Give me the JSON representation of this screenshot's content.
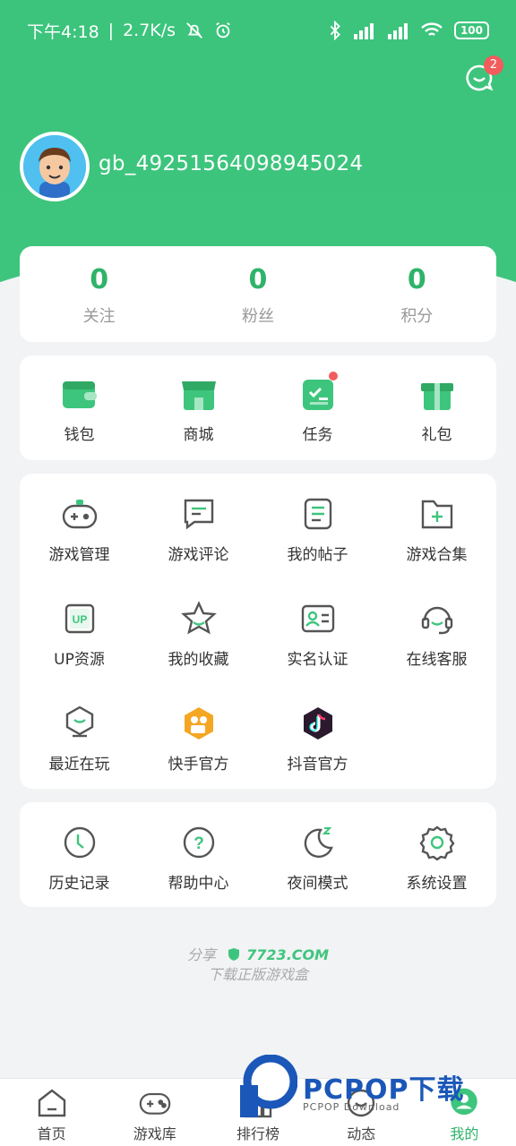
{
  "status_bar": {
    "time": "下午4:18",
    "speed": "2.7K/s",
    "battery": "100"
  },
  "header": {
    "message_badge": "2",
    "username": "gb_49251564098945024"
  },
  "stats": [
    {
      "value": "0",
      "label": "关注"
    },
    {
      "value": "0",
      "label": "粉丝"
    },
    {
      "value": "0",
      "label": "积分"
    }
  ],
  "wallet_row": [
    {
      "label": "钱包",
      "icon": "wallet-icon"
    },
    {
      "label": "商城",
      "icon": "shop-icon"
    },
    {
      "label": "任务",
      "icon": "task-icon"
    },
    {
      "label": "礼包",
      "icon": "gift-icon"
    }
  ],
  "tools": [
    {
      "label": "游戏管理",
      "icon": "gamepad-icon"
    },
    {
      "label": "游戏评论",
      "icon": "comment-icon"
    },
    {
      "label": "我的帖子",
      "icon": "post-icon"
    },
    {
      "label": "游戏合集",
      "icon": "folder-plus-icon"
    },
    {
      "label": "UP资源",
      "icon": "up-icon",
      "icon_text": "UP"
    },
    {
      "label": "我的收藏",
      "icon": "star-icon"
    },
    {
      "label": "实名认证",
      "icon": "id-card-icon"
    },
    {
      "label": "在线客服",
      "icon": "headset-icon"
    },
    {
      "label": "最近在玩",
      "icon": "recent-icon"
    },
    {
      "label": "快手官方",
      "icon": "kuaishou-icon"
    },
    {
      "label": "抖音官方",
      "icon": "douyin-icon"
    }
  ],
  "misc": [
    {
      "label": "历史记录",
      "icon": "clock-icon"
    },
    {
      "label": "帮助中心",
      "icon": "help-icon",
      "icon_text": "?"
    },
    {
      "label": "夜间模式",
      "icon": "moon-icon"
    },
    {
      "label": "系统设置",
      "icon": "gear-icon"
    }
  ],
  "footer": {
    "share": "分享",
    "brand": "7723.COM",
    "tagline": "下载正版游戏盒"
  },
  "bottom_nav": [
    {
      "label": "首页",
      "icon": "home-icon"
    },
    {
      "label": "游戏库",
      "icon": "game-library-icon"
    },
    {
      "label": "排行榜",
      "icon": "ranking-icon"
    },
    {
      "label": "动态",
      "icon": "feed-icon"
    },
    {
      "label": "我的",
      "icon": "profile-icon",
      "active": true
    }
  ],
  "watermark": {
    "text": "PCPOP下载",
    "sub": "PCPOP Download"
  },
  "colors": {
    "accent": "#3ec57d",
    "accent_dark": "#2fb36a",
    "badge": "#f25c5c",
    "background": "#f2f3f5"
  }
}
